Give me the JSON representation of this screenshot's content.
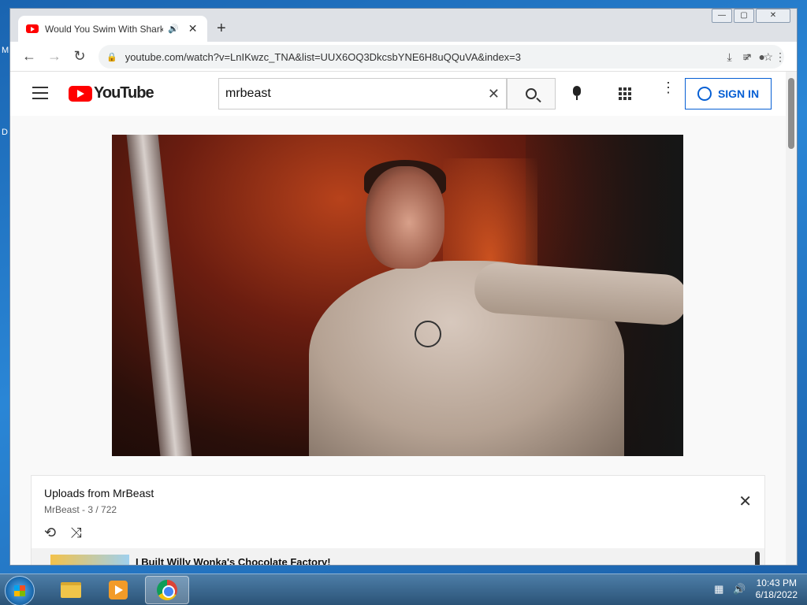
{
  "desktop": {
    "edge_glyph_top": "M",
    "edge_glyph_mid": "D"
  },
  "browser": {
    "tab": {
      "title": "Would You Swim With Shark",
      "audio_icon": "speaker-icon",
      "close": "✕"
    },
    "new_tab": "+",
    "window_controls": {
      "minimize": "—",
      "maximize": "▢",
      "close": "✕"
    },
    "url": "youtube.com/watch?v=LnIKwzc_TNA&list=UUX6OQ3DkcsbYNE6H8uQQuVA&index=3"
  },
  "youtube": {
    "logo": "YouTube",
    "search": {
      "value": "mrbeast"
    },
    "sign_in": "SIGN IN"
  },
  "playlist": {
    "title": "Uploads from MrBeast",
    "subtitle": "MrBeast - 3 / 722",
    "next_item_title": "I Built Willy Wonka's Chocolate Factory!"
  },
  "taskbar": {
    "time": "10:43 PM",
    "date": "6/18/2022"
  }
}
